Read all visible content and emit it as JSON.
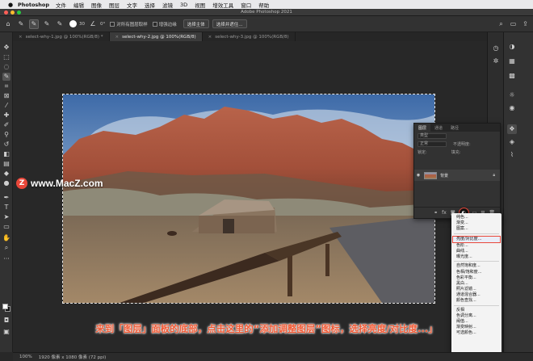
{
  "menubar": {
    "app_name": "Photoshop",
    "items": [
      "文件",
      "编辑",
      "图像",
      "图层",
      "文字",
      "选择",
      "滤镜",
      "3D",
      "视图",
      "增效工具",
      "窗口",
      "帮助"
    ]
  },
  "window": {
    "title": "Adobe Photoshop 2021"
  },
  "options_bar": {
    "brush_size": "30",
    "angle_value": "0°",
    "sample_all_layers_label": "对所有图层取样",
    "enhance_edge_label": "增强边缘",
    "select_subject_button": "选择主体",
    "select_and_mask_button": "选择并遮住..."
  },
  "tabs": [
    {
      "label": "select-why-1.jpg @ 100%(RGB/8) *",
      "active": false
    },
    {
      "label": "select-why-2.jpg @ 100%(RGB/8)",
      "active": true
    },
    {
      "label": "select-why-3.jpg @ 100%(RGB/8)",
      "active": false
    }
  ],
  "layers_panel": {
    "tabs": [
      "图层",
      "通道",
      "路径"
    ],
    "kind_label": "类型",
    "blend_mode": "正常",
    "opacity_label": "不透明度:",
    "lock_label": "锁定:",
    "fill_label": "填充:",
    "layer_name": "背景"
  },
  "adjustment_menu": {
    "groups": [
      [
        "纯色...",
        "渐变...",
        "图案..."
      ],
      [
        "亮度/对比度...",
        "色阶...",
        "曲线...",
        "曝光度..."
      ],
      [
        "自然饱和度...",
        "色相/饱和度...",
        "色彩平衡...",
        "黑白...",
        "照片滤镜...",
        "通道混合器...",
        "颜色查找..."
      ],
      [
        "反相",
        "色调分离...",
        "阈值...",
        "渐变映射...",
        "可选颜色..."
      ]
    ],
    "highlighted": "亮度/对比度..."
  },
  "watermark": {
    "logo_letter": "Z",
    "text": "www.MacZ.com"
  },
  "caption": "来到「图层」面板的底部，点击这里的“添加调整图层”图标，选择亮度/对比度...」",
  "status_bar": {
    "zoom": "100%",
    "doc_info": "1920 像素 x 1080 像素 (72 ppi)"
  },
  "colors": {
    "accent_red": "#e9473a",
    "caption_orange": "#f05a35",
    "ui_dark": "#323232"
  }
}
